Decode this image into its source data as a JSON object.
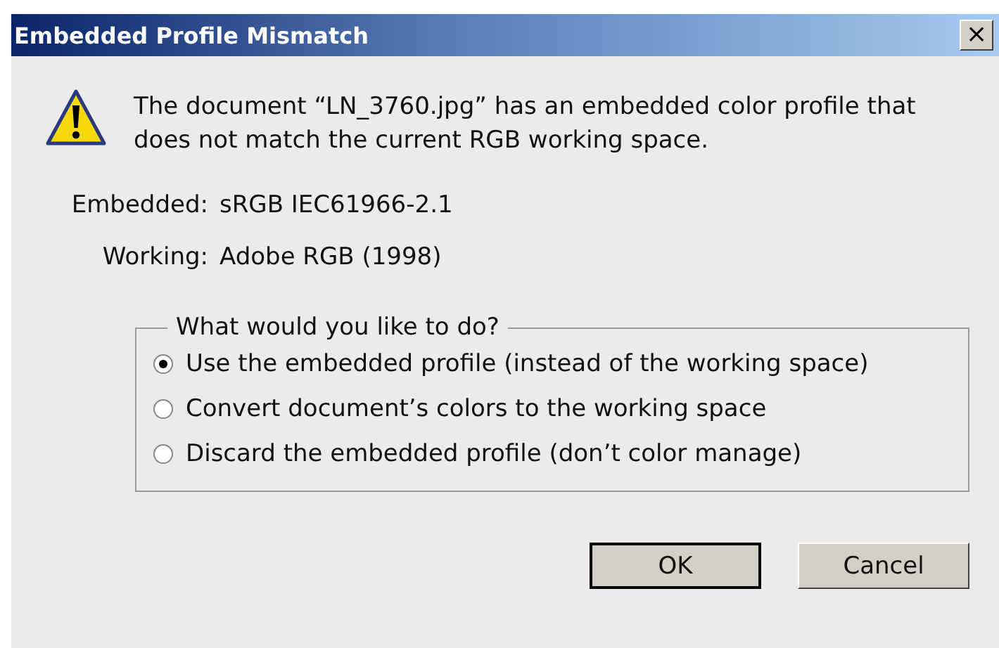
{
  "window": {
    "title": "Embedded Profile Mismatch",
    "close": "×"
  },
  "message": "The document “LN_3760.jpg” has an embedded color profile that does not match the current RGB working space.",
  "profiles": [
    {
      "label": "Embedded:",
      "value": "sRGB IEC61966-2.1"
    },
    {
      "label": "Working:",
      "value": "Adobe RGB (1998)"
    }
  ],
  "group": {
    "title": "What would you like to do?",
    "options": [
      {
        "label": "Use the embedded profile (instead of the working space)",
        "selected": true
      },
      {
        "label": "Convert document’s colors to the working space",
        "selected": false
      },
      {
        "label": "Discard the embedded profile (don’t color manage)",
        "selected": false
      }
    ]
  },
  "buttons": [
    {
      "label": "OK",
      "default": true
    },
    {
      "label": "Cancel",
      "default": false
    }
  ]
}
